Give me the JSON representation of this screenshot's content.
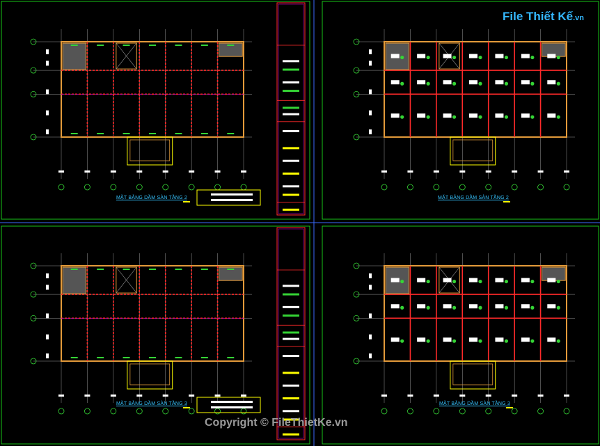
{
  "logo": {
    "text": "File Thiết Kế",
    "suffix": ".vn"
  },
  "copyright": "Copyright © FileThietKe.vn",
  "sheets": [
    {
      "caption": "MẶT BẰNG DẦM SÀN TẦNG 2"
    },
    {
      "caption": "MẶT BẰNG DẦM SÀN TẦNG 2"
    },
    {
      "caption": "MẶT BẰNG DẦM SÀN TẦNG 3"
    },
    {
      "caption": "MẶT BẰNG DẦM SÀN TẦNG 3"
    }
  ],
  "colors": {
    "background": "#000000",
    "frame_green": "#19c419",
    "frame_blue": "#3b6cff",
    "beam_red": "#ff2a2a",
    "beam_orange": "#e39a3a",
    "grid_gray": "#9a9a9a",
    "label_green": "#35d435",
    "yellow": "#ffff00",
    "magenta": "#c000c0",
    "caption_cyan": "#36c3ff"
  }
}
